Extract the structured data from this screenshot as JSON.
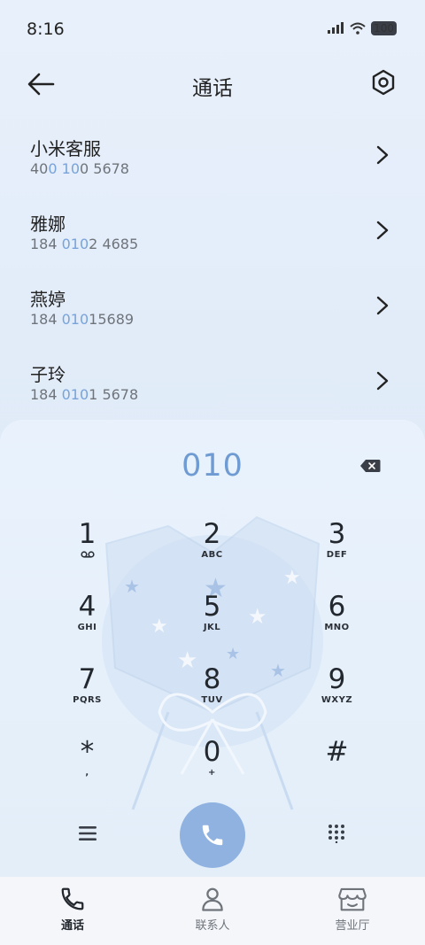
{
  "status_bar": {
    "time": "8:16",
    "signal_icon": "signal-icon",
    "wifi_icon": "wifi-icon",
    "battery_text": "100"
  },
  "header": {
    "title": "通话",
    "back_icon": "back-arrow-icon",
    "settings_icon": "settings-icon"
  },
  "results": [
    {
      "name": "小米客服",
      "number_parts": [
        "40",
        "0",
        " ",
        "10",
        "0 5678"
      ]
    },
    {
      "name": "雅娜",
      "number_parts": [
        "184 ",
        "010",
        "2 4685"
      ]
    },
    {
      "name": "燕婷",
      "number_parts": [
        "184 ",
        "010",
        "15689"
      ]
    },
    {
      "name": "子玲",
      "number_parts": [
        "184 ",
        "010",
        "1 5678"
      ]
    }
  ],
  "dialer": {
    "input": "010",
    "keys": [
      {
        "digit": "1",
        "letters": ""
      },
      {
        "digit": "2",
        "letters": "ABC"
      },
      {
        "digit": "3",
        "letters": "DEF"
      },
      {
        "digit": "4",
        "letters": "GHI"
      },
      {
        "digit": "5",
        "letters": "JKL"
      },
      {
        "digit": "6",
        "letters": "MNO"
      },
      {
        "digit": "7",
        "letters": "PQRS"
      },
      {
        "digit": "8",
        "letters": "TUV"
      },
      {
        "digit": "9",
        "letters": "WXYZ"
      },
      {
        "digit": "*",
        "letters": ","
      },
      {
        "digit": "0",
        "letters": "+"
      },
      {
        "digit": "#",
        "letters": ""
      }
    ]
  },
  "bottom_nav": {
    "items": [
      {
        "label": "通话",
        "icon": "phone-icon",
        "active": true
      },
      {
        "label": "联系人",
        "icon": "person-icon",
        "active": false
      },
      {
        "label": "营业厅",
        "icon": "store-icon",
        "active": false
      }
    ]
  },
  "colors": {
    "accent": "#78a3d9",
    "call_button": "#8fb2e0"
  }
}
